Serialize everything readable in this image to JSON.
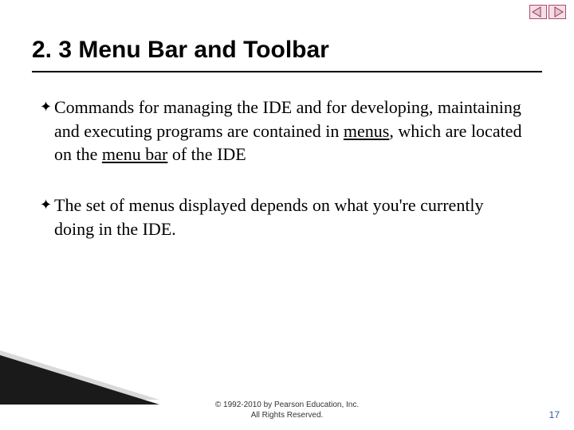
{
  "title": "2. 3  Menu Bar and Toolbar",
  "bullets": [
    {
      "pre": "Commands for managing the IDE and for developing, maintaining and executing programs are contained in ",
      "u1": "menus",
      "mid": ", which are located on the ",
      "u2": "menu bar",
      "post": " of the IDE"
    },
    {
      "text": "The set of menus displayed depends on what you're currently doing in the IDE."
    }
  ],
  "footer": {
    "line1": "© 1992-2010 by Pearson Education, Inc.",
    "line2": "All Rights Reserved."
  },
  "pageNumber": "17",
  "icons": {
    "prev": "prev-arrow-icon",
    "next": "next-arrow-icon"
  }
}
